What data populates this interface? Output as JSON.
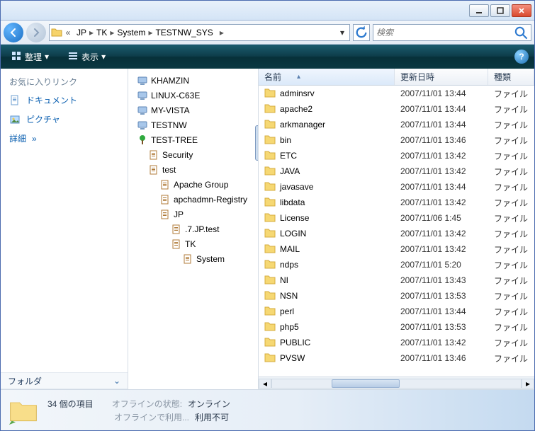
{
  "breadcrumb": [
    "JP",
    "TK",
    "System",
    "TESTNW_SYS"
  ],
  "search": {
    "placeholder": "検索"
  },
  "toolbar": {
    "organize": "整理",
    "views": "表示"
  },
  "favorites": {
    "header": "お気に入りリンク",
    "docs": "ドキュメント",
    "pics": "ピクチャ",
    "more": "詳細",
    "folders": "フォルダ"
  },
  "tree": [
    {
      "label": "KHAMZIN",
      "indent": 0,
      "icon": "pc"
    },
    {
      "label": "LINUX-C63E",
      "indent": 0,
      "icon": "pc"
    },
    {
      "label": "MY-VISTA",
      "indent": 0,
      "icon": "pc"
    },
    {
      "label": "TESTNW",
      "indent": 0,
      "icon": "pc"
    },
    {
      "label": "TEST-TREE",
      "indent": 0,
      "icon": "tree"
    },
    {
      "label": "Security",
      "indent": 1,
      "icon": "reg"
    },
    {
      "label": "test",
      "indent": 1,
      "icon": "reg"
    },
    {
      "label": "Apache Group",
      "indent": 2,
      "icon": "reg"
    },
    {
      "label": "apchadmn-Registry",
      "indent": 2,
      "icon": "reg"
    },
    {
      "label": "JP",
      "indent": 2,
      "icon": "reg"
    },
    {
      "label": ".7.JP.test",
      "indent": 3,
      "icon": "reg"
    },
    {
      "label": "TK",
      "indent": 3,
      "icon": "reg"
    },
    {
      "label": "System",
      "indent": 4,
      "icon": "reg"
    }
  ],
  "columns": {
    "name": "名前",
    "modified": "更新日時",
    "type": "種類"
  },
  "files": [
    {
      "name": "adminsrv",
      "date": "2007/11/01 13:44",
      "type": "ファイル"
    },
    {
      "name": "apache2",
      "date": "2007/11/01 13:44",
      "type": "ファイル"
    },
    {
      "name": "arkmanager",
      "date": "2007/11/01 13:44",
      "type": "ファイル"
    },
    {
      "name": "bin",
      "date": "2007/11/01 13:46",
      "type": "ファイル"
    },
    {
      "name": "ETC",
      "date": "2007/11/01 13:42",
      "type": "ファイル"
    },
    {
      "name": "JAVA",
      "date": "2007/11/01 13:42",
      "type": "ファイル"
    },
    {
      "name": "javasave",
      "date": "2007/11/01 13:44",
      "type": "ファイル"
    },
    {
      "name": "libdata",
      "date": "2007/11/01 13:42",
      "type": "ファイル"
    },
    {
      "name": "License",
      "date": "2007/11/06 1:45",
      "type": "ファイル"
    },
    {
      "name": "LOGIN",
      "date": "2007/11/01 13:42",
      "type": "ファイル"
    },
    {
      "name": "MAIL",
      "date": "2007/11/01 13:42",
      "type": "ファイル"
    },
    {
      "name": "ndps",
      "date": "2007/11/01 5:20",
      "type": "ファイル"
    },
    {
      "name": "NI",
      "date": "2007/11/01 13:43",
      "type": "ファイル"
    },
    {
      "name": "NSN",
      "date": "2007/11/01 13:53",
      "type": "ファイル"
    },
    {
      "name": "perl",
      "date": "2007/11/01 13:44",
      "type": "ファイル"
    },
    {
      "name": "php5",
      "date": "2007/11/01 13:53",
      "type": "ファイル"
    },
    {
      "name": "PUBLIC",
      "date": "2007/11/01 13:42",
      "type": "ファイル"
    },
    {
      "name": "PVSW",
      "date": "2007/11/01 13:46",
      "type": "ファイル"
    }
  ],
  "status": {
    "count": "34 個の項目",
    "offline_state_k": "オフラインの状態:",
    "offline_state_v": "オンライン",
    "offline_use_k": "オフラインで利用...",
    "offline_use_v": "利用不可"
  }
}
